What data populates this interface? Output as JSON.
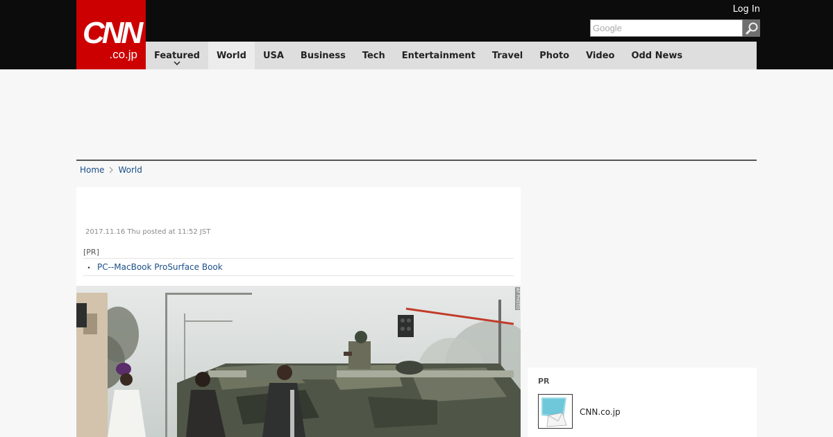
{
  "header": {
    "logo_main": "CNN",
    "logo_sub": ".co.jp",
    "login_label": "Log In",
    "search_placeholder": "Google"
  },
  "nav": {
    "items": [
      {
        "label": "Featured"
      },
      {
        "label": "World"
      },
      {
        "label": "USA"
      },
      {
        "label": "Business"
      },
      {
        "label": "Tech"
      },
      {
        "label": "Entertainment"
      },
      {
        "label": "Travel"
      },
      {
        "label": "Photo"
      },
      {
        "label": "Video"
      },
      {
        "label": "Odd News"
      }
    ],
    "active": "World"
  },
  "breadcrumb": {
    "home": "Home",
    "current": "World"
  },
  "article": {
    "posted": "2017.11.16 Thu posted at 11:52 JST",
    "pr_label": "[PR]",
    "pr_link_bullet": "・",
    "pr_link": "PC--MacBook ProSurface Book",
    "photo_credit": "AP PHOTO"
  },
  "sidebar_pr": {
    "label": "PR",
    "text": "CNN.co.jp"
  },
  "colors": {
    "brand_red": "#cc0000",
    "header_bg": "#0c0c0c",
    "nav_bg": "#dedede",
    "link": "#1a4f88"
  }
}
